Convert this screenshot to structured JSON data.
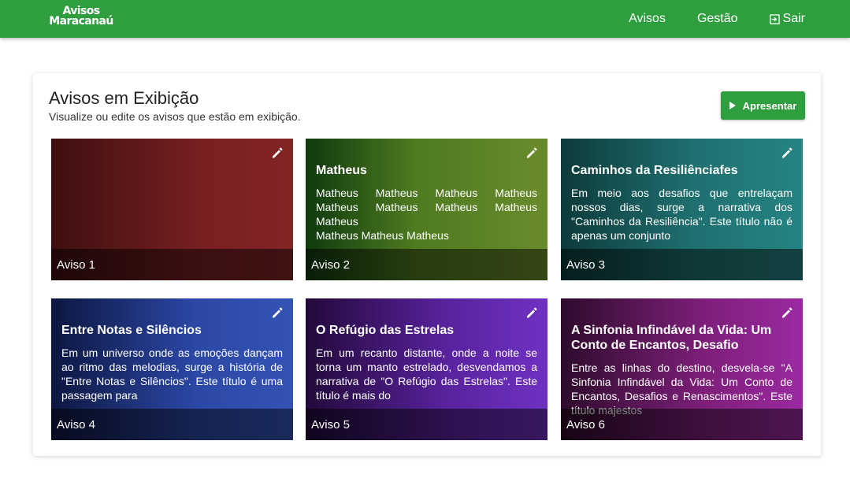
{
  "header": {
    "logo_line1": "Avisos",
    "logo_line2": "Maracanaú",
    "nav": {
      "avisos": "Avisos",
      "gestao": "Gestão",
      "sair": "Sair"
    },
    "background_color": "#2e9e3e"
  },
  "main": {
    "title": "Avisos em Exibição",
    "subtitle": "Visualize ou edite os avisos que estão em exibição.",
    "present_button": "Apresentar"
  },
  "cards": [
    {
      "label": "Aviso 1",
      "title": "",
      "body": "",
      "color": "#7a2022"
    },
    {
      "label": "Aviso 2",
      "title": "Matheus",
      "body": "Matheus Matheus Matheus Matheus Matheus Matheus Matheus Matheus Matheus",
      "body_line2": "Matheus Matheus Matheus",
      "color": "#4e7a20"
    },
    {
      "label": "Aviso 3",
      "title": "Caminhos da Resiliênciafes",
      "body": "Em meio aos desafios que entrelaçam nossos dias, surge a narrativa dos \"Caminhos da Resiliência\". Este título não é apenas um conjunto",
      "color": "#1f7070"
    },
    {
      "label": "Aviso 4",
      "title": "Entre Notas e Silêncios",
      "body": "Em um universo onde as emoções dançam ao ritmo das melodias, surge a história de \"Entre Notas e Silêncios\". Este título é uma passagem para",
      "color": "#2c48a6"
    },
    {
      "label": "Aviso 5",
      "title": "O Refúgio das Estrelas",
      "body": "Em um recanto distante, onde a noite se torna um manto estrelado, desvendamos a narrativa de \"O Refúgio das Estrelas\". Este título é mais do",
      "color": "#5a23a0"
    },
    {
      "label": "Aviso 6",
      "title": "A Sinfonia Infindável da Vida: Um Conto de Encantos, Desafio",
      "body": "Entre as linhas do destino, desvela-se \"A Sinfonia Infindável da Vida: Um Conto de Encantos, Desafios e Renascimentos\". Este título majestos",
      "color": "#7e1f7a"
    }
  ]
}
